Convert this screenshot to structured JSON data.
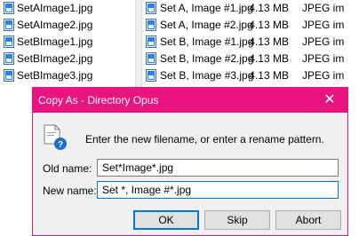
{
  "left_files": [
    {
      "name": "SetAImage1.jpg",
      "icon": "jpeg-file-icon"
    },
    {
      "name": "SetAImage2.jpg",
      "icon": "jpeg-file-icon"
    },
    {
      "name": "SetBImage1.jpg",
      "icon": "jpeg-file-icon"
    },
    {
      "name": "SetBImage2.jpg",
      "icon": "jpeg-file-icon"
    },
    {
      "name": "SetBImage3.jpg",
      "icon": "jpeg-file-icon"
    }
  ],
  "right_files": [
    {
      "name": "Set A, Image #1.jpg",
      "size": "4.13 MB",
      "type": "JPEG im"
    },
    {
      "name": "Set A, Image #2.jpg",
      "size": "4.13 MB",
      "type": "JPEG im"
    },
    {
      "name": "Set B, Image #1.jpg",
      "size": "4.13 MB",
      "type": "JPEG im"
    },
    {
      "name": "Set B, Image #2.jpg",
      "size": "4.13 MB",
      "type": "JPEG im"
    },
    {
      "name": "Set B, Image #3.jpg",
      "size": "4.13 MB",
      "type": "JPEG im"
    }
  ],
  "dialog": {
    "title": "Copy As - Directory Opus",
    "close_glyph": "✕",
    "instruction": "Enter the new filename, or enter a rename pattern.",
    "old_name_label": "Old name:",
    "old_name_value": "Set*Image*.jpg",
    "new_name_label": "New name:",
    "new_name_value": "Set *, Image #*.jpg",
    "buttons": {
      "ok": "OK",
      "skip": "Skip",
      "abort": "Abort"
    }
  },
  "colors": {
    "accent": "#e8157f",
    "focus": "#0078d7"
  }
}
